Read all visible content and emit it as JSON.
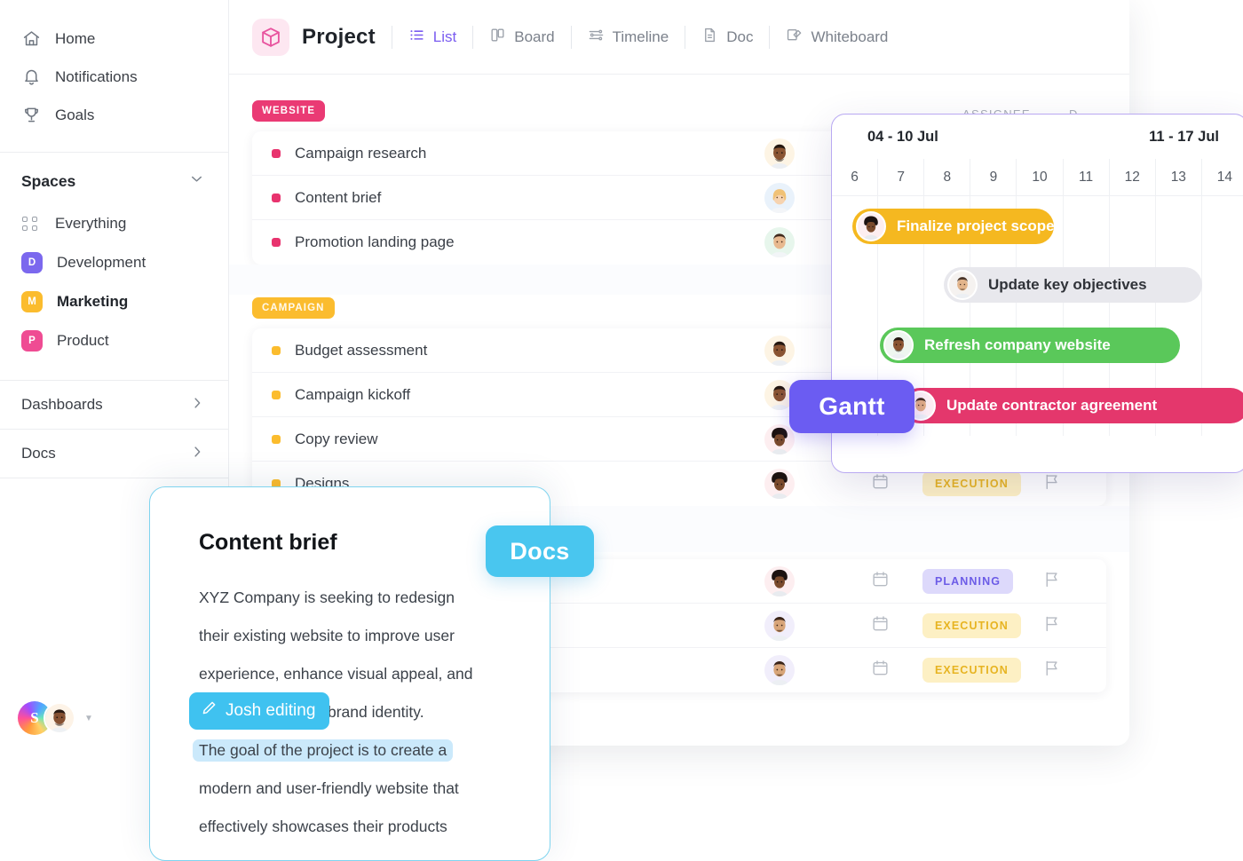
{
  "sidebar": {
    "nav": [
      {
        "label": "Home",
        "icon": "home-icon"
      },
      {
        "label": "Notifications",
        "icon": "bell-icon"
      },
      {
        "label": "Goals",
        "icon": "trophy-icon"
      }
    ],
    "spaces_header": {
      "label": "Spaces",
      "icon": "chevron-down-icon"
    },
    "spaces": [
      {
        "label": "Everything",
        "initial": "",
        "color": "",
        "icon": "grid-dots-icon",
        "active": false
      },
      {
        "label": "Development",
        "initial": "D",
        "color": "#7b68ee",
        "active": false
      },
      {
        "label": "Marketing",
        "initial": "M",
        "color": "#fbbc2e",
        "active": true
      },
      {
        "label": "Product",
        "initial": "P",
        "color": "#ef4c93",
        "active": false
      }
    ],
    "links": [
      {
        "label": "Dashboards",
        "icon": "chevron-right-icon"
      },
      {
        "label": "Docs",
        "icon": "chevron-right-icon"
      }
    ],
    "user": {
      "initial": "S",
      "caret": "caret-down-icon"
    }
  },
  "header": {
    "project_icon": "cube-icon",
    "title": "Project",
    "tabs": [
      {
        "label": "List",
        "icon": "list-icon",
        "active": true
      },
      {
        "label": "Board",
        "icon": "board-icon",
        "active": false
      },
      {
        "label": "Timeline",
        "icon": "timeline-icon",
        "active": false
      },
      {
        "label": "Doc",
        "icon": "doc-icon",
        "active": false
      },
      {
        "label": "Whiteboard",
        "icon": "whiteboard-icon",
        "active": false
      }
    ]
  },
  "table": {
    "columns": {
      "assignee": "ASSIGNEE",
      "due": "D"
    },
    "groups": [
      {
        "tag": "WEBSITE",
        "tag_color": "#ea3a74",
        "bullet_color": "#e8336e",
        "rows": [
          {
            "name": "Campaign research",
            "status": "",
            "status_kind": ""
          },
          {
            "name": "Content brief",
            "status": "",
            "status_kind": ""
          },
          {
            "name": "Promotion landing page",
            "status": "",
            "status_kind": ""
          }
        ]
      },
      {
        "tag": "CAMPAIGN",
        "tag_color": "#fbbc2e",
        "bullet_color": "#fbbc2e",
        "rows": [
          {
            "name": "Budget assessment",
            "status": "",
            "status_kind": ""
          },
          {
            "name": "Campaign kickoff",
            "status": "",
            "status_kind": ""
          },
          {
            "name": "Copy review",
            "status": "",
            "status_kind": ""
          },
          {
            "name": "Designs",
            "status": "EXECUTION",
            "status_kind": "exec"
          }
        ]
      },
      {
        "tag": "",
        "tag_color": "",
        "bullet_color": "",
        "rows": [
          {
            "name": "",
            "status": "PLANNING",
            "status_kind": "plan"
          },
          {
            "name": "",
            "status": "EXECUTION",
            "status_kind": "exec"
          },
          {
            "name": "",
            "status": "EXECUTION",
            "status_kind": "exec"
          }
        ]
      }
    ]
  },
  "gantt": {
    "pill_label": "Gantt",
    "pill_color": "#6b5cf2",
    "weeks": [
      "04 - 10 Jul",
      "11 - 17 Jul"
    ],
    "days": [
      "6",
      "7",
      "8",
      "9",
      "10",
      "11",
      "12",
      "13",
      "14"
    ],
    "bars": [
      {
        "label": "Finalize project scope",
        "color": "#f5b820",
        "text_color": "#ffffff",
        "start_col": 0.45,
        "span": 4.35,
        "row": 0
      },
      {
        "label": "Update key objectives",
        "color": "#e5e5ea",
        "text_color": "#303339",
        "start_col": 2.45,
        "span": 5.1,
        "row": 1
      },
      {
        "label": "Refresh company website",
        "color": "#5ac85a",
        "text_color": "#ffffff",
        "start_col": 1.05,
        "span": 6.25,
        "row": 2
      },
      {
        "label": "Update contractor agreement",
        "color": "#e4376c",
        "text_color": "#ffffff",
        "start_col": 1.55,
        "span": 7.45,
        "row": 3
      }
    ]
  },
  "docs": {
    "pill_label": "Docs",
    "pill_color": "#49c6ef",
    "title": "Content brief",
    "lines": [
      {
        "text": "XYZ Company is seeking to redesign",
        "highlight": false
      },
      {
        "text": "their existing website to improve user",
        "highlight": false
      },
      {
        "text": "experience, enhance visual appeal, and",
        "highlight": false
      },
      {
        "text": "establish a unified brand identity.",
        "highlight": false
      },
      {
        "text": "The goal of the project is to create a",
        "highlight": true
      },
      {
        "text": "modern and user-friendly website that",
        "highlight": false
      },
      {
        "text": "effectively showcases their products",
        "highlight": false
      }
    ],
    "cursor": {
      "label": "Josh editing",
      "icon": "pencil-icon",
      "color": "#3fc2f0"
    }
  }
}
